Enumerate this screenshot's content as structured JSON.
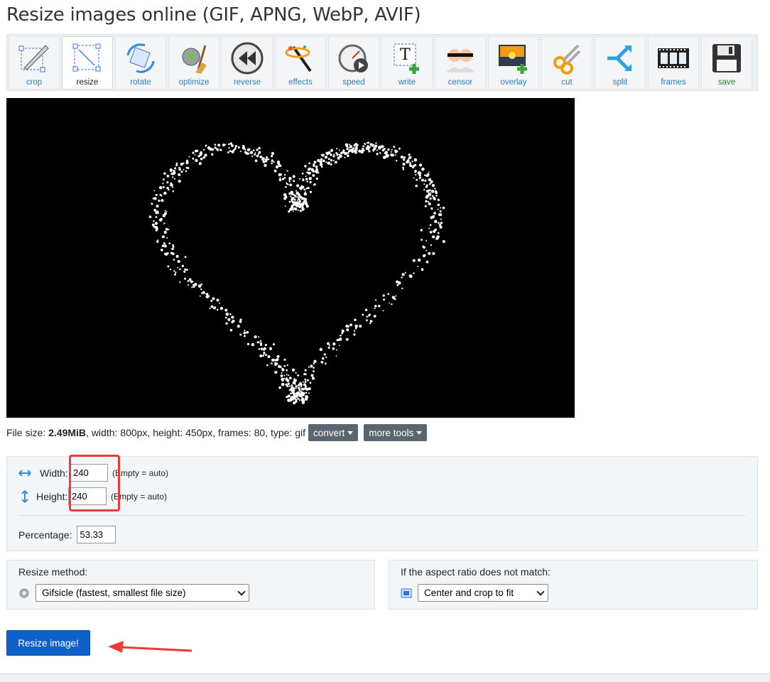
{
  "page": {
    "title": "Resize images online (GIF, APNG, WebP, AVIF)"
  },
  "toolbar": [
    {
      "id": "crop",
      "label": "crop",
      "icon": "crop-icon"
    },
    {
      "id": "resize",
      "label": "resize",
      "icon": "resize-icon",
      "active": true
    },
    {
      "id": "rotate",
      "label": "rotate",
      "icon": "rotate-icon"
    },
    {
      "id": "optimize",
      "label": "optimize",
      "icon": "optimize-icon"
    },
    {
      "id": "reverse",
      "label": "reverse",
      "icon": "reverse-icon"
    },
    {
      "id": "effects",
      "label": "effects",
      "icon": "effects-icon"
    },
    {
      "id": "speed",
      "label": "speed",
      "icon": "speed-icon"
    },
    {
      "id": "write",
      "label": "write",
      "icon": "write-icon"
    },
    {
      "id": "censor",
      "label": "censor",
      "icon": "censor-icon"
    },
    {
      "id": "overlay",
      "label": "overlay",
      "icon": "overlay-icon"
    },
    {
      "id": "cut",
      "label": "cut",
      "icon": "scissors-icon"
    },
    {
      "id": "split",
      "label": "split",
      "icon": "split-icon"
    },
    {
      "id": "frames",
      "label": "frames",
      "icon": "film-frames-icon"
    },
    {
      "id": "save",
      "label": "save",
      "icon": "floppy-disk-icon"
    }
  ],
  "fileinfo": {
    "prefix": "File size: ",
    "size": "2.49MiB",
    "rest": ", width: 800px, height: 450px, frames: 80, type: gif",
    "convert_label": "convert",
    "more_tools_label": "more tools"
  },
  "dimensions": {
    "width_label": "Width:",
    "width_value": "240",
    "width_hint": "(Empty = auto)",
    "height_label": "Height:",
    "height_value": "240",
    "height_hint": "(Empty = auto)",
    "percentage_label": "Percentage:",
    "percentage_value": "53.33"
  },
  "method": {
    "label": "Resize method:",
    "selected": "Gifsicle (fastest, smallest file size)"
  },
  "aspect": {
    "label": "If the aspect ratio does not match:",
    "selected": "Center and crop to fit"
  },
  "submit": {
    "label": "Resize image!"
  },
  "colors": {
    "accent": "#0d63c9",
    "annotation": "#ec3a3a",
    "link": "#337ab7"
  }
}
